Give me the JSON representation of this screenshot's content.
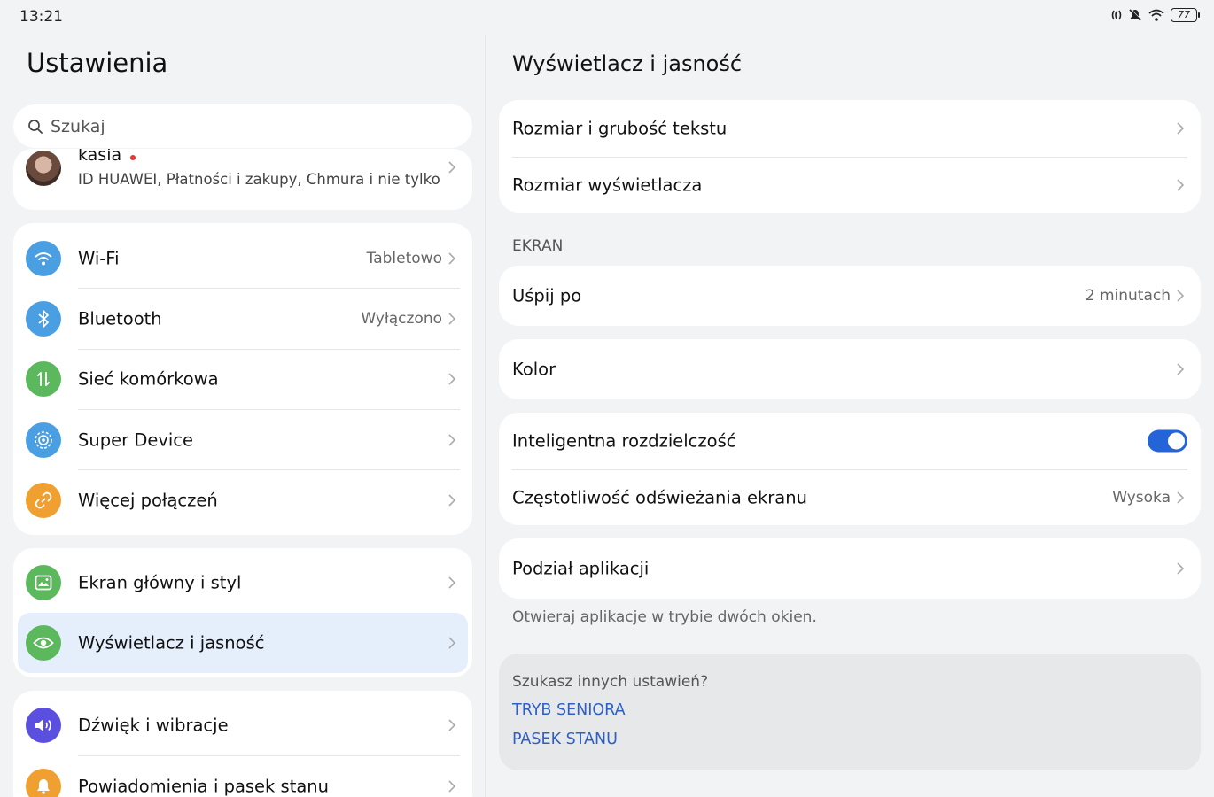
{
  "status_bar": {
    "time": "13:21",
    "battery": "77"
  },
  "left": {
    "title": "Ustawienia",
    "search_placeholder": "Szukaj",
    "account": {
      "name": "kasia",
      "subtitle": "ID HUAWEI, Płatności i zakupy, Chmura i nie tylko"
    },
    "group1": [
      {
        "label": "Wi-Fi",
        "value": "Tabletowo",
        "icon": "wifi-icon",
        "color": "#4a9fe3"
      },
      {
        "label": "Bluetooth",
        "value": "Wyłączono",
        "icon": "bluetooth-icon",
        "color": "#4a9fe3"
      },
      {
        "label": "Sieć komórkowa",
        "value": "",
        "icon": "mobile-data-icon",
        "color": "#5cb85c"
      },
      {
        "label": "Super Device",
        "value": "",
        "icon": "super-device-icon",
        "color": "#4a9fe3"
      },
      {
        "label": "Więcej połączeń",
        "value": "",
        "icon": "link-icon",
        "color": "#f0a030"
      }
    ],
    "group2": [
      {
        "label": "Ekran główny i styl",
        "icon": "image-icon",
        "color": "#5cb85c"
      },
      {
        "label": "Wyświetlacz i jasność",
        "icon": "eye-icon",
        "color": "#5cb85c"
      }
    ],
    "group3": [
      {
        "label": "Dźwięk i wibracje",
        "icon": "speaker-icon",
        "color": "#5b4fe0"
      },
      {
        "label": "Powiadomienia i pasek stanu",
        "icon": "bell-icon",
        "color": "#f0a030"
      }
    ]
  },
  "right": {
    "title": "Wyświetlacz i jasność",
    "text_size": "Rozmiar i grubość tekstu",
    "display_size": "Rozmiar wyświetlacza",
    "section_screen": "EKRAN",
    "sleep_label": "Uśpij po",
    "sleep_value": "2 minutach",
    "color_label": "Kolor",
    "smart_res_label": "Inteligentna rozdzielczość",
    "refresh_label": "Częstotliwość odświeżania ekranu",
    "refresh_value": "Wysoka",
    "split_label": "Podział aplikacji",
    "split_hint": "Otwieraj aplikacje w trybie dwóch okien.",
    "suggest_title": "Szukasz innych ustawień?",
    "suggest_link1": "TRYB SENIORA",
    "suggest_link2": "PASEK STANU"
  }
}
